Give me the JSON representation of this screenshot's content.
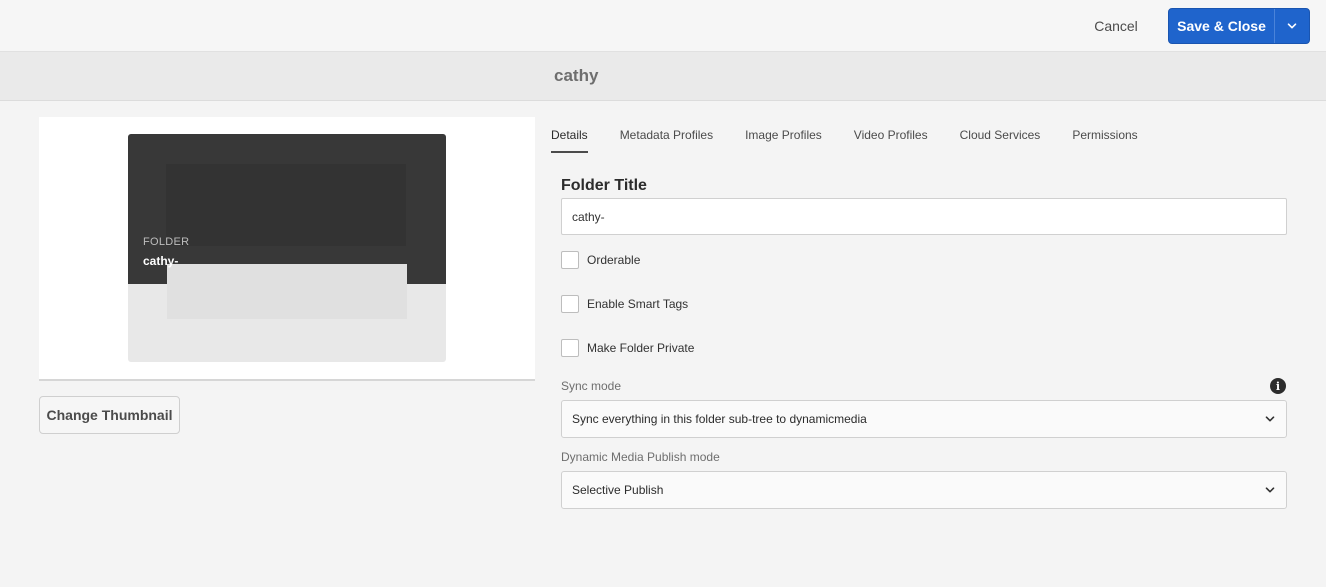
{
  "actions": {
    "cancel_label": "Cancel",
    "save_label": "Save & Close",
    "primary_color": "#1f64cc",
    "dropdown_icon": "chevron-down-icon"
  },
  "header": {
    "title": "cathy"
  },
  "preview": {
    "type_label": "FOLDER",
    "name": "cathy-",
    "change_thumbnail_label": "Change Thumbnail"
  },
  "tabs": [
    {
      "label": "Details",
      "active": true
    },
    {
      "label": "Metadata Profiles",
      "active": false
    },
    {
      "label": "Image Profiles",
      "active": false
    },
    {
      "label": "Video Profiles",
      "active": false
    },
    {
      "label": "Cloud Services",
      "active": false
    },
    {
      "label": "Permissions",
      "active": false
    }
  ],
  "form": {
    "folder_title_label": "Folder Title",
    "folder_title_value": "cathy-",
    "checkboxes": [
      {
        "label": "Orderable",
        "checked": false
      },
      {
        "label": "Enable Smart Tags",
        "checked": false
      },
      {
        "label": "Make Folder Private",
        "checked": false
      }
    ],
    "sync_mode": {
      "label": "Sync mode",
      "value": "Sync everything in this folder sub-tree to dynamicmedia",
      "info_icon": "info-icon"
    },
    "publish_mode": {
      "label": "Dynamic Media Publish mode",
      "value": "Selective Publish"
    }
  }
}
